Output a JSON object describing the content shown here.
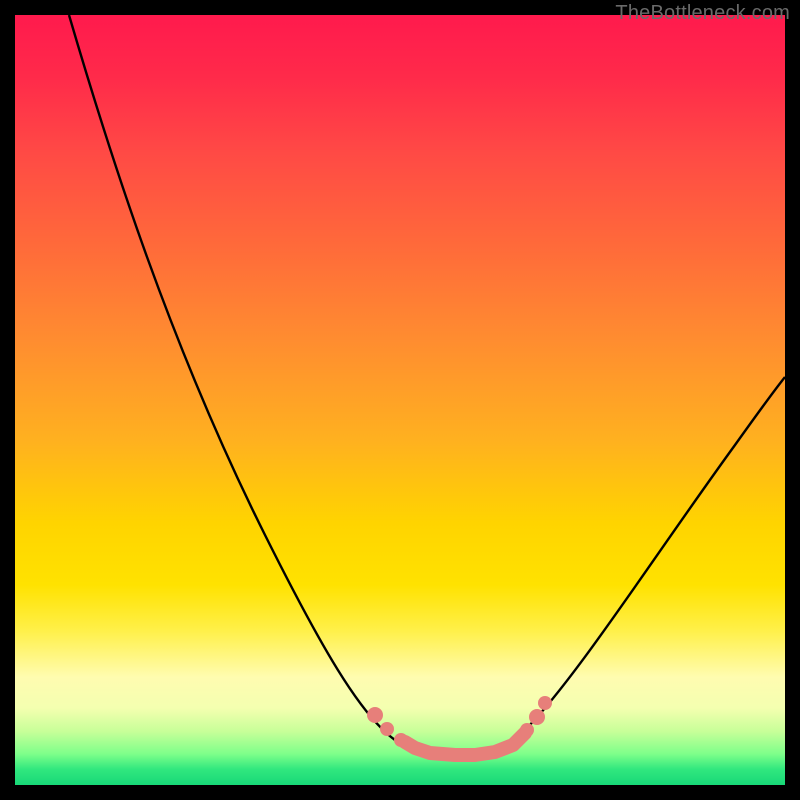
{
  "watermark": "TheBottleneck.com",
  "chart_data": {
    "type": "line",
    "title": "",
    "xlabel": "",
    "ylabel": "",
    "xlim": [
      0,
      100
    ],
    "ylim": [
      0,
      100
    ],
    "grid": false,
    "legend": "none",
    "series": [
      {
        "name": "bottleneck-curve",
        "x": [
          7,
          12,
          18,
          24,
          30,
          35,
          40,
          45,
          48,
          50,
          52,
          55,
          58,
          60,
          63,
          68,
          74,
          80,
          86,
          92,
          98,
          100
        ],
        "values": [
          100,
          90,
          78,
          66,
          54,
          43,
          33,
          22,
          14,
          8,
          4,
          2,
          2,
          3,
          6,
          12,
          22,
          32,
          41,
          49,
          56,
          58
        ]
      }
    ],
    "markers": {
      "name": "dip-markers",
      "x": [
        46,
        48,
        50,
        53,
        55,
        58,
        60,
        63,
        65
      ],
      "values": [
        11,
        7,
        4,
        2,
        2,
        2,
        3,
        6,
        9
      ]
    },
    "background_gradient": {
      "top": "#ff1a4d",
      "mid": "#ffd400",
      "bottom": "#18d878"
    }
  }
}
